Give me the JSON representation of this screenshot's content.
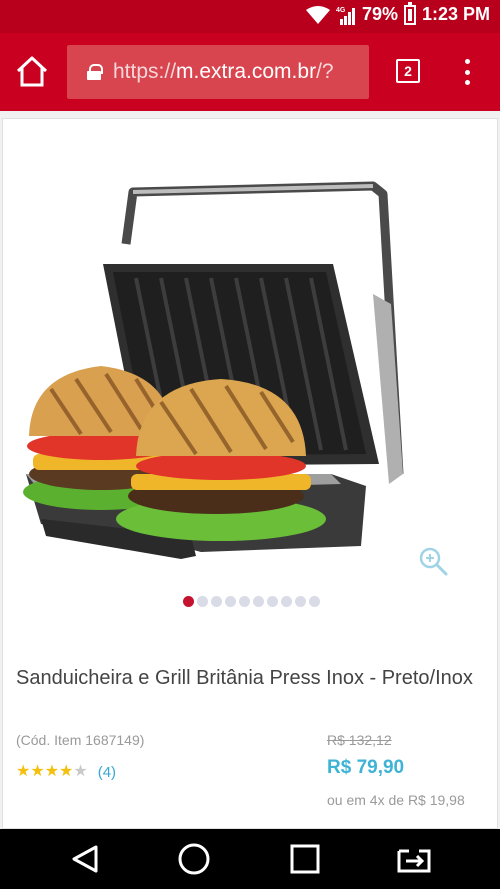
{
  "status_bar": {
    "network": "4G",
    "battery": "79%",
    "time": "1:23 PM"
  },
  "browser": {
    "url_scheme": "https://",
    "url_host": "m.extra.com.br",
    "url_rest": "/?",
    "tab_count": "2"
  },
  "gallery": {
    "image_alt": "Sanduicheira e Grill Britânia Press Inox",
    "dot_count": 10,
    "active_index": 0
  },
  "product": {
    "title": "Sanduicheira e Grill Britânia Press Inox - Preto/Inox",
    "sku": "(Cód. Item 1687149)",
    "rating_stars": 4,
    "rating_max": 5,
    "rating_count": "(4)",
    "old_price": "R$ 132,12",
    "price": "R$ 79,90",
    "installments": "ou em 4x de R$ 19,98"
  },
  "colors": {
    "brand": "#c90020",
    "price": "#3eb3d6",
    "star": "#f3c00d",
    "active_dot": "#c4122f"
  },
  "icons": [
    "home-icon",
    "lock-icon",
    "tabs-icon",
    "overflow-menu-icon",
    "zoom-in-icon",
    "back-icon",
    "home-circle-icon",
    "recents-icon",
    "switch-app-icon"
  ]
}
